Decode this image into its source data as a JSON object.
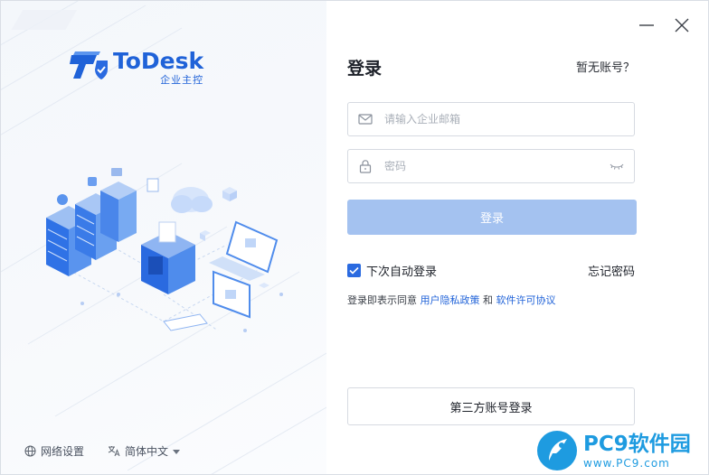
{
  "brand": {
    "name": "ToDesk",
    "subtitle": "企业主控",
    "color": "#1f62d8"
  },
  "window": {
    "minimize_icon": "minimize-icon",
    "close_icon": "close-icon"
  },
  "login": {
    "title": "登录",
    "no_account": "暂无账号？",
    "email_placeholder": "请输入企业邮箱",
    "password_placeholder": "密码",
    "submit_label": "登录",
    "auto_login_label": "下次自动登录",
    "auto_login_checked": true,
    "forgot_label": "忘记密码",
    "agree_prefix": "登录即表示同意",
    "privacy_link": "用户隐私政策",
    "agree_and": "和",
    "license_link": "软件许可协议",
    "third_party_label": "第三方账号登录"
  },
  "footer": {
    "network_label": "网络设置",
    "language_label": "简体中文"
  },
  "watermark": {
    "main": "PC9软件园",
    "sub": "www.PC9.com"
  },
  "colors": {
    "primary": "#2a6ae0",
    "primary_disabled": "#a4c2f0",
    "link": "#1f62d8",
    "watermark": "#1e9be0"
  }
}
